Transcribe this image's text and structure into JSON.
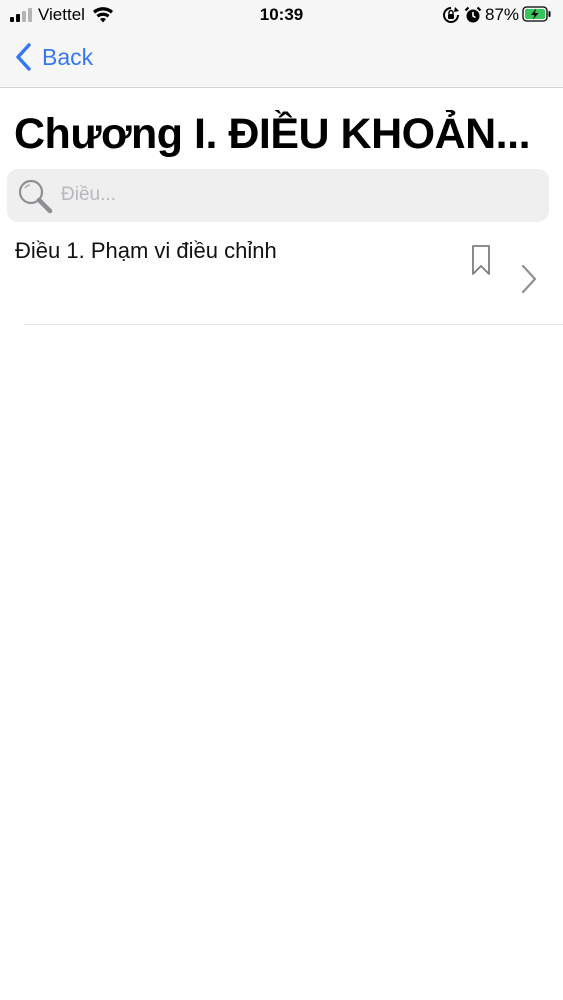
{
  "status_bar": {
    "carrier": "Viettel",
    "time": "10:39",
    "battery_percent": "87%",
    "signal_icon": "cellular-signal-icon",
    "wifi_icon": "wifi-icon",
    "rotation_lock_icon": "rotation-lock-icon",
    "alarm_icon": "alarm-icon",
    "battery_icon": "battery-charging-icon",
    "battery_color": "#34c759"
  },
  "nav": {
    "back_label": "Back",
    "back_icon": "chevron-left-icon",
    "accent_color": "#3478f6"
  },
  "page": {
    "title": "Chương I. ĐIỀU KHOẢN..."
  },
  "search": {
    "placeholder": "Điều...",
    "value": "",
    "icon": "search-icon"
  },
  "articles": [
    {
      "title": "Điều 1. Phạm vi điều chỉnh",
      "bookmark_icon": "bookmark-icon",
      "chevron_icon": "chevron-right-icon"
    }
  ]
}
